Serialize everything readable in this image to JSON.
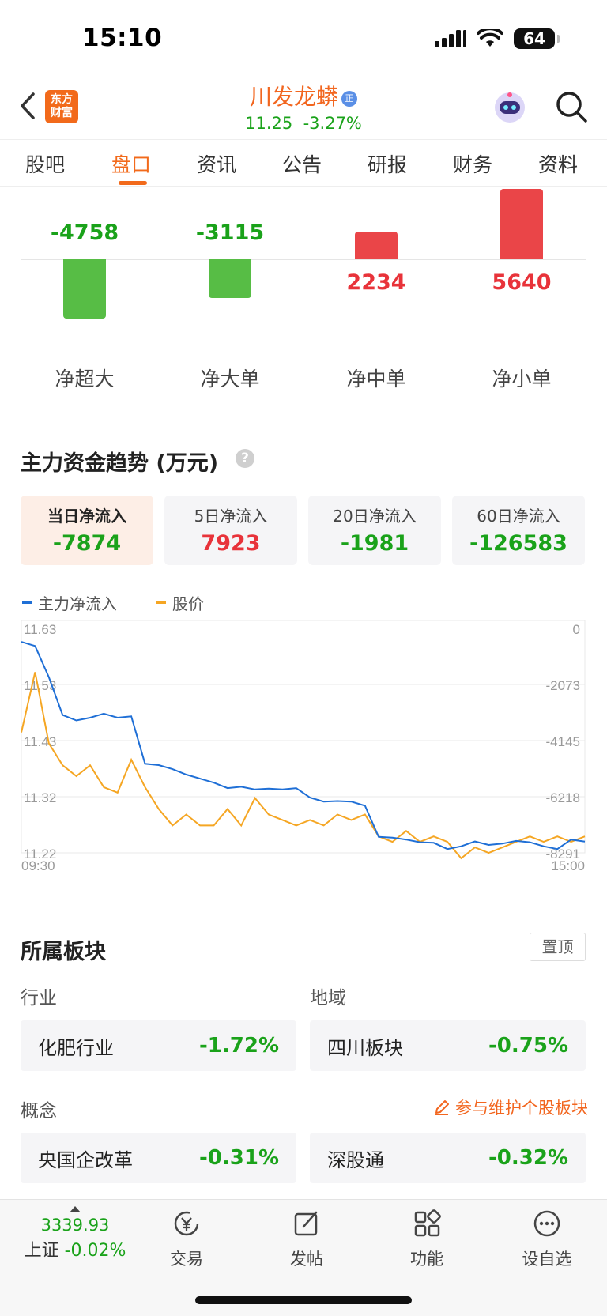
{
  "status_bar": {
    "time": "15:10",
    "battery": "64"
  },
  "header": {
    "logo_line1": "东方",
    "logo_line2": "财富",
    "stock_name": "川发龙蟒",
    "badge": "正",
    "price": "11.25",
    "change_pct": "-3.27%"
  },
  "tabs": [
    "股吧",
    "盘口",
    "资讯",
    "公告",
    "研报",
    "财务",
    "资料"
  ],
  "active_tab": "盘口",
  "net_flow": [
    {
      "label": "净超大",
      "value": -4758
    },
    {
      "label": "净大单",
      "value": -3115
    },
    {
      "label": "净中单",
      "value": 2234
    },
    {
      "label": "净小单",
      "value": 5640
    }
  ],
  "trend": {
    "title": "主力资金趋势 (万元)",
    "help": "?",
    "cards": [
      {
        "label": "当日净流入",
        "value": "-7874"
      },
      {
        "label": "5日净流入",
        "value": "7923"
      },
      {
        "label": "20日净流入",
        "value": "-1981"
      },
      {
        "label": "60日净流入",
        "value": "-126583"
      }
    ]
  },
  "chart_data": {
    "type": "line",
    "legend": [
      "主力净流入",
      "股价"
    ],
    "colors": {
      "main_flow": "#1f6fd6",
      "price": "#f5a623",
      "positive": "#e8333a",
      "negative": "#1aa21a"
    },
    "x_start": "09:30",
    "x_end": "15:00",
    "left_axis_ticks": [
      "11.63",
      "11.53",
      "11.43",
      "11.32",
      "11.22"
    ],
    "right_axis_ticks": [
      "0",
      "-2073",
      "-4145",
      "-6218",
      "-8291"
    ],
    "left_range": [
      11.22,
      11.63
    ],
    "right_range": [
      -8291,
      0
    ],
    "series": [
      {
        "name": "主力净流入",
        "values": [
          -500,
          -650,
          -1800,
          -3200,
          -3400,
          -3300,
          -3150,
          -3300,
          -3250,
          -5000,
          -5050,
          -5200,
          -5400,
          -5550,
          -5700,
          -5900,
          -5850,
          -5950,
          -5920,
          -5950,
          -5900,
          -6250,
          -6400,
          -6380,
          -6400,
          -6550,
          -7700,
          -7730,
          -7800,
          -7900,
          -7920,
          -8150,
          -8050,
          -7870,
          -8000,
          -7950,
          -7850,
          -7900,
          -8050,
          -8150,
          -7800,
          -7874
        ]
      },
      {
        "name": "股价",
        "values": [
          11.44,
          11.55,
          11.42,
          11.38,
          11.36,
          11.38,
          11.34,
          11.33,
          11.39,
          11.34,
          11.3,
          11.27,
          11.29,
          11.27,
          11.27,
          11.3,
          11.27,
          11.32,
          11.29,
          11.28,
          11.27,
          11.28,
          11.27,
          11.29,
          11.28,
          11.29,
          11.25,
          11.24,
          11.26,
          11.24,
          11.25,
          11.24,
          11.21,
          11.23,
          11.22,
          11.23,
          11.24,
          11.25,
          11.24,
          11.25,
          11.24,
          11.25
        ]
      }
    ]
  },
  "boards": {
    "title": "所属板块",
    "pin_label": "置顶",
    "industry_label": "行业",
    "region_label": "地域",
    "industry": {
      "name": "化肥行业",
      "pct": "-1.72%"
    },
    "region": {
      "name": "四川板块",
      "pct": "-0.75%"
    },
    "concept_label": "概念",
    "edit_label": "参与维护个股板块",
    "concepts": [
      {
        "name": "央国企改革",
        "pct": "-0.31%"
      },
      {
        "name": "深股通",
        "pct": "-0.32%"
      }
    ]
  },
  "bottom_nav": {
    "index_value": "3339.93",
    "index_name": "上证",
    "index_pct": "-0.02%",
    "items": [
      "交易",
      "发帖",
      "功能",
      "设自选"
    ]
  }
}
